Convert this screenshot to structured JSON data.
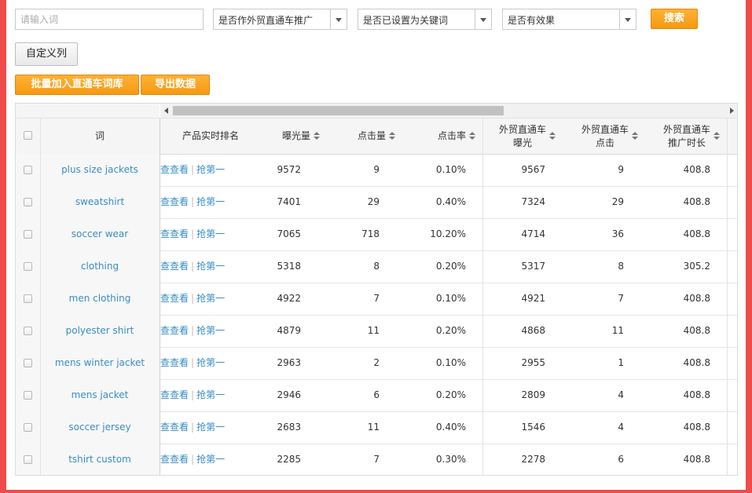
{
  "filters": {
    "search_placeholder": "请输入词",
    "select1": "是否作外贸直通车推广",
    "select2": "是否已设置为关键词",
    "select3": "是否有效果",
    "search_button": "搜索"
  },
  "toolbar": {
    "custom_columns": "自定义列",
    "batch_add": "批量加入直通车词库",
    "export": "导出数据"
  },
  "table": {
    "headers": {
      "keyword": "词",
      "rank": "产品实时排名",
      "exposure": "曝光量",
      "clicks": "点击量",
      "ctr": "点击率",
      "p4p_exposure_l1": "外贸直通车",
      "p4p_exposure_l2": "曝光",
      "p4p_clicks_l1": "外贸直通车",
      "p4p_clicks_l2": "点击",
      "p4p_duration_l1": "外贸直通车",
      "p4p_duration_l2": "推广时长"
    },
    "actions": {
      "view": "查查看",
      "grab": "抢第一",
      "separator": "|"
    },
    "rows": [
      {
        "keyword": "plus size jackets",
        "exposure": "9572",
        "clicks": "9",
        "ctr": "0.10%",
        "p4p_exposure": "9567",
        "p4p_clicks": "9",
        "p4p_duration": "408.8"
      },
      {
        "keyword": "sweatshirt",
        "exposure": "7401",
        "clicks": "29",
        "ctr": "0.40%",
        "p4p_exposure": "7324",
        "p4p_clicks": "29",
        "p4p_duration": "408.8"
      },
      {
        "keyword": "soccer wear",
        "exposure": "7065",
        "clicks": "718",
        "ctr": "10.20%",
        "p4p_exposure": "4714",
        "p4p_clicks": "36",
        "p4p_duration": "408.8"
      },
      {
        "keyword": "clothing",
        "exposure": "5318",
        "clicks": "8",
        "ctr": "0.20%",
        "p4p_exposure": "5317",
        "p4p_clicks": "8",
        "p4p_duration": "305.2"
      },
      {
        "keyword": "men clothing",
        "exposure": "4922",
        "clicks": "7",
        "ctr": "0.10%",
        "p4p_exposure": "4921",
        "p4p_clicks": "7",
        "p4p_duration": "408.8"
      },
      {
        "keyword": "polyester shirt",
        "exposure": "4879",
        "clicks": "11",
        "ctr": "0.20%",
        "p4p_exposure": "4868",
        "p4p_clicks": "11",
        "p4p_duration": "408.8"
      },
      {
        "keyword": "mens winter jacket",
        "exposure": "2963",
        "clicks": "2",
        "ctr": "0.10%",
        "p4p_exposure": "2955",
        "p4p_clicks": "1",
        "p4p_duration": "408.8"
      },
      {
        "keyword": "mens jacket",
        "exposure": "2946",
        "clicks": "6",
        "ctr": "0.20%",
        "p4p_exposure": "2809",
        "p4p_clicks": "4",
        "p4p_duration": "408.8"
      },
      {
        "keyword": "soccer jersey",
        "exposure": "2683",
        "clicks": "11",
        "ctr": "0.40%",
        "p4p_exposure": "1546",
        "p4p_clicks": "4",
        "p4p_duration": "408.8"
      },
      {
        "keyword": "tshirt custom",
        "exposure": "2285",
        "clicks": "7",
        "ctr": "0.30%",
        "p4p_exposure": "2278",
        "p4p_clicks": "6",
        "p4p_duration": "408.8"
      }
    ]
  },
  "colors": {
    "accent_orange": "#f59a11",
    "link_blue": "#3a8dc4",
    "frame_red": "#ef4b4b"
  }
}
